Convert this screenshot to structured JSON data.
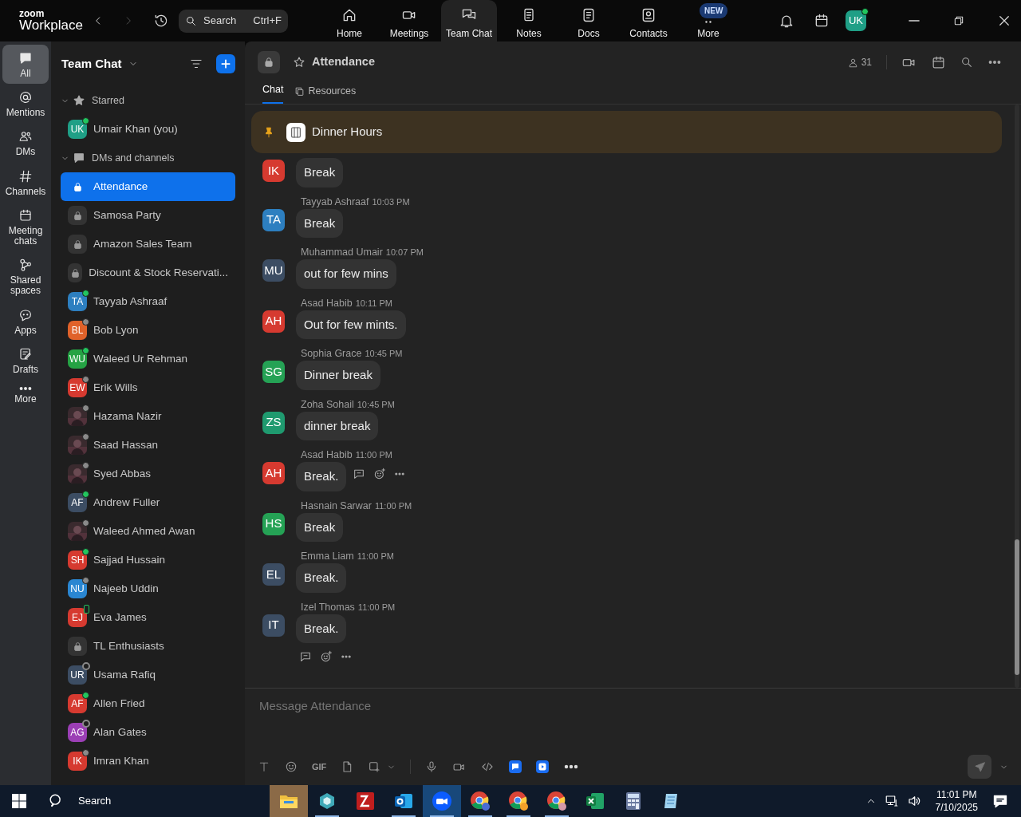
{
  "app": {
    "brand_small": "zoom",
    "brand": "Workplace"
  },
  "search": {
    "placeholder": "Search",
    "shortcut": "Ctrl+F"
  },
  "nav_tabs": [
    {
      "label": "Home",
      "selected": false
    },
    {
      "label": "Meetings",
      "selected": false
    },
    {
      "label": "Team Chat",
      "selected": true
    },
    {
      "label": "Notes",
      "selected": false
    },
    {
      "label": "Docs",
      "selected": false
    },
    {
      "label": "Contacts",
      "selected": false
    },
    {
      "label": "More",
      "selected": false,
      "badge": "NEW"
    }
  ],
  "user_avatar": {
    "initials": "UK",
    "color": "#1f9f86",
    "status": {
      "color": "#22c55e",
      "hollow": false,
      "mobile": false
    }
  },
  "rail": [
    {
      "label": "All",
      "selected": true
    },
    {
      "label": "Mentions",
      "selected": false
    },
    {
      "label": "DMs",
      "selected": false
    },
    {
      "label": "Channels",
      "selected": false
    },
    {
      "label": "Meeting chats",
      "selected": false
    },
    {
      "label": "Shared spaces",
      "selected": false
    },
    {
      "label": "Apps",
      "selected": false
    },
    {
      "label": "Drafts",
      "selected": false
    },
    {
      "label": "More",
      "selected": false
    }
  ],
  "sidebar": {
    "title": "Team Chat",
    "sections": [
      {
        "label": "Starred",
        "expanded": true,
        "items": [
          {
            "kind": "person",
            "initials": "UK",
            "color": "#1f9f86",
            "status": {
              "color": "#22c55e",
              "hollow": false,
              "mobile": false
            },
            "name": "Umair Khan (you)",
            "selected": false
          }
        ]
      },
      {
        "label": "DMs and channels",
        "expanded": true,
        "items": [
          {
            "kind": "channel",
            "name": "Attendance",
            "selected": true
          },
          {
            "kind": "channel",
            "name": "Samosa Party",
            "selected": false
          },
          {
            "kind": "channel",
            "name": "Amazon Sales Team",
            "selected": false
          },
          {
            "kind": "channel",
            "name": "Discount & Stock Reservati...",
            "selected": false
          },
          {
            "kind": "person",
            "initials": "TA",
            "color": "#2d7fc0",
            "status": {
              "color": "#22c55e",
              "hollow": false,
              "mobile": false
            },
            "name": "Tayyab Ashraaf",
            "selected": false
          },
          {
            "kind": "person",
            "initials": "BL",
            "color": "#e0622a",
            "status": {
              "color": "#8a8a8a",
              "hollow": false,
              "mobile": false
            },
            "name": "Bob Lyon",
            "selected": false
          },
          {
            "kind": "person",
            "initials": "WU",
            "color": "#25a244",
            "status": {
              "color": "#22c55e",
              "hollow": false,
              "mobile": false
            },
            "name": "Waleed Ur Rehman",
            "selected": false
          },
          {
            "kind": "person",
            "initials": "EW",
            "color": "#d63a30",
            "status": {
              "color": "#8a8a8a",
              "hollow": false,
              "mobile": false
            },
            "name": "Erik Wills",
            "selected": false
          },
          {
            "status": {
              "color": "#8a8a8a",
              "hollow": false,
              "mobile": false
            },
            "name": "Hazama Nazir",
            "selected": false
          },
          {
            "status": {
              "color": "#8a8a8a",
              "hollow": false,
              "mobile": false
            },
            "name": "Saad Hassan",
            "selected": false
          },
          {
            "status": {
              "color": "#8a8a8a",
              "hollow": false,
              "mobile": false
            },
            "name": "Syed Abbas",
            "selected": false
          },
          {
            "kind": "person",
            "initials": "AF",
            "color": "#3c4d63",
            "status": {
              "color": "#22c55e",
              "hollow": false,
              "mobile": false
            },
            "name": "Andrew Fuller",
            "selected": false
          },
          {
            "status": {
              "color": "#8a8a8a",
              "hollow": false,
              "mobile": false
            },
            "name": "Waleed Ahmed Awan",
            "selected": false
          },
          {
            "kind": "person",
            "initials": "SH",
            "color": "#d63a30",
            "status": {
              "color": "#22c55e",
              "hollow": false,
              "mobile": false
            },
            "name": "Sajjad Hussain",
            "selected": false
          },
          {
            "kind": "person",
            "initials": "NU",
            "color": "#2a86d1",
            "status": {
              "color": "#8a8a8a",
              "hollow": false,
              "mobile": false
            },
            "name": "Najeeb Uddin",
            "selected": false
          },
          {
            "kind": "person",
            "initials": "EJ",
            "color": "#d63a30",
            "status": {
              "color": "#22c55e",
              "hollow": true,
              "mobile": true
            },
            "name": "Eva James",
            "selected": false
          },
          {
            "kind": "channel",
            "name": "TL Enthusiasts",
            "selected": false
          },
          {
            "kind": "person",
            "initials": "UR",
            "color": "#3c4d63",
            "status": {
              "color": "#8a8a8a",
              "hollow": true,
              "mobile": false
            },
            "name": "Usama Rafiq",
            "selected": false
          },
          {
            "kind": "person",
            "initials": "AF",
            "color": "#d63a30",
            "status": {
              "color": "#22c55e",
              "hollow": false,
              "mobile": false
            },
            "name": "Allen Fried",
            "selected": false
          },
          {
            "kind": "person",
            "initials": "AG",
            "color": "#9b3fb5",
            "status": {
              "color": "#8a8a8a",
              "hollow": true,
              "mobile": false
            },
            "name": "Alan Gates",
            "selected": false
          },
          {
            "kind": "person",
            "initials": "IK",
            "color": "#d63a30",
            "status": {
              "color": "#8a8a8a",
              "hollow": false,
              "mobile": false
            },
            "name": "Imran Khan",
            "selected": false
          }
        ]
      }
    ]
  },
  "channel": {
    "title": "Attendance",
    "member_count": "31",
    "tabs": [
      {
        "label": "Chat",
        "selected": true
      },
      {
        "label": "Resources",
        "selected": false
      }
    ]
  },
  "pinned": {
    "title": "Dinner Hours"
  },
  "messages": [
    {
      "initials": "IK",
      "color": "#d63a30",
      "text": "Break"
    },
    {
      "initials": "TA",
      "color": "#2d7fc0",
      "sender": "Tayyab Ashraaf",
      "time": "10:03 PM",
      "text": "Break"
    },
    {
      "initials": "MU",
      "color": "#3c4d63",
      "sender": "Muhammad Umair",
      "time": "10:07 PM",
      "text": "out for few mins"
    },
    {
      "initials": "AH",
      "color": "#d63a30",
      "sender": "Asad Habib",
      "time": "10:11 PM",
      "text": "Out for few mints."
    },
    {
      "initials": "SG",
      "color": "#25a255",
      "sender": "Sophia Grace",
      "time": "10:45 PM",
      "text": "Dinner break"
    },
    {
      "initials": "ZS",
      "color": "#1f9a6f",
      "sender": "Zoha Sohail",
      "time": "10:45 PM",
      "text": "dinner break"
    },
    {
      "initials": "AH",
      "color": "#d63a30",
      "sender": "Asad Habib",
      "time": "11:00 PM",
      "text": "Break.",
      "hover_actions": true
    },
    {
      "initials": "HS",
      "color": "#25a255",
      "sender": "Hasnain Sarwar",
      "time": "11:00 PM",
      "text": "Break"
    },
    {
      "initials": "EL",
      "color": "#3c4d63",
      "sender": "Emma Liam",
      "time": "11:00 PM",
      "text": "Break."
    },
    {
      "initials": "IT",
      "color": "#3c4d63",
      "sender": "Izel Thomas",
      "time": "11:00 PM",
      "text": "Break.",
      "footer_actions": true
    }
  ],
  "composer": {
    "placeholder": "Message Attendance",
    "gif_label": "GIF",
    "send_disabled": true
  },
  "taskbar": {
    "search": "Search",
    "apps": [
      {
        "hovered": true,
        "selected": false,
        "running": false
      },
      {
        "hovered": false,
        "selected": false,
        "running": true
      },
      {
        "hovered": false,
        "selected": false,
        "running": false
      },
      {
        "hovered": false,
        "selected": false,
        "running": true
      },
      {
        "hovered": false,
        "selected": true,
        "running": true
      },
      {
        "hovered": false,
        "selected": false,
        "running": true
      },
      {
        "hovered": false,
        "selected": false,
        "running": true
      },
      {
        "hovered": false,
        "selected": false,
        "running": true
      },
      {
        "hovered": false,
        "selected": false,
        "running": false
      },
      {
        "hovered": false,
        "selected": false,
        "running": false
      },
      {
        "hovered": false,
        "selected": false,
        "running": false
      }
    ],
    "time": "11:01 PM",
    "date": "7/10/2025"
  }
}
